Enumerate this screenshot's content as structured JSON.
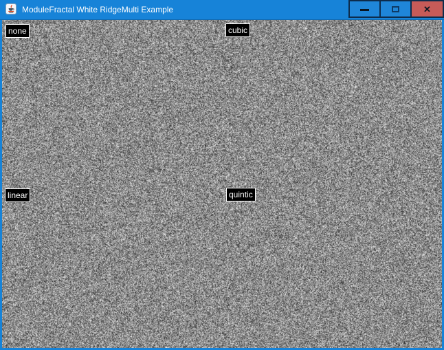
{
  "window": {
    "title": "ModuleFractal White RidgeMulti Example",
    "app_icon": "java-coffee-cup-icon",
    "controls": {
      "minimize": {
        "name": "minimize-button",
        "glyph": "dash"
      },
      "maximize": {
        "name": "maximize-button",
        "glyph": "square-outline"
      },
      "close": {
        "name": "close-button",
        "glyph": "✕"
      }
    }
  },
  "client": {
    "content": "grayscale-white-noise-texture",
    "labels": [
      {
        "text": "none",
        "quadrant": "top-left"
      },
      {
        "text": "cubic",
        "quadrant": "top-right"
      },
      {
        "text": "linear",
        "quadrant": "bottom-left"
      },
      {
        "text": "quintic",
        "quadrant": "bottom-right"
      }
    ]
  },
  "colors": {
    "titlebar_blue": "#1783d8",
    "window_border_blue": "#1783d8",
    "button_border": "#0d2c4c",
    "close_button_red": "#c75b58",
    "glyph_dark": "#0a1622",
    "label_background": "#000000",
    "label_text": "#ffffff"
  }
}
